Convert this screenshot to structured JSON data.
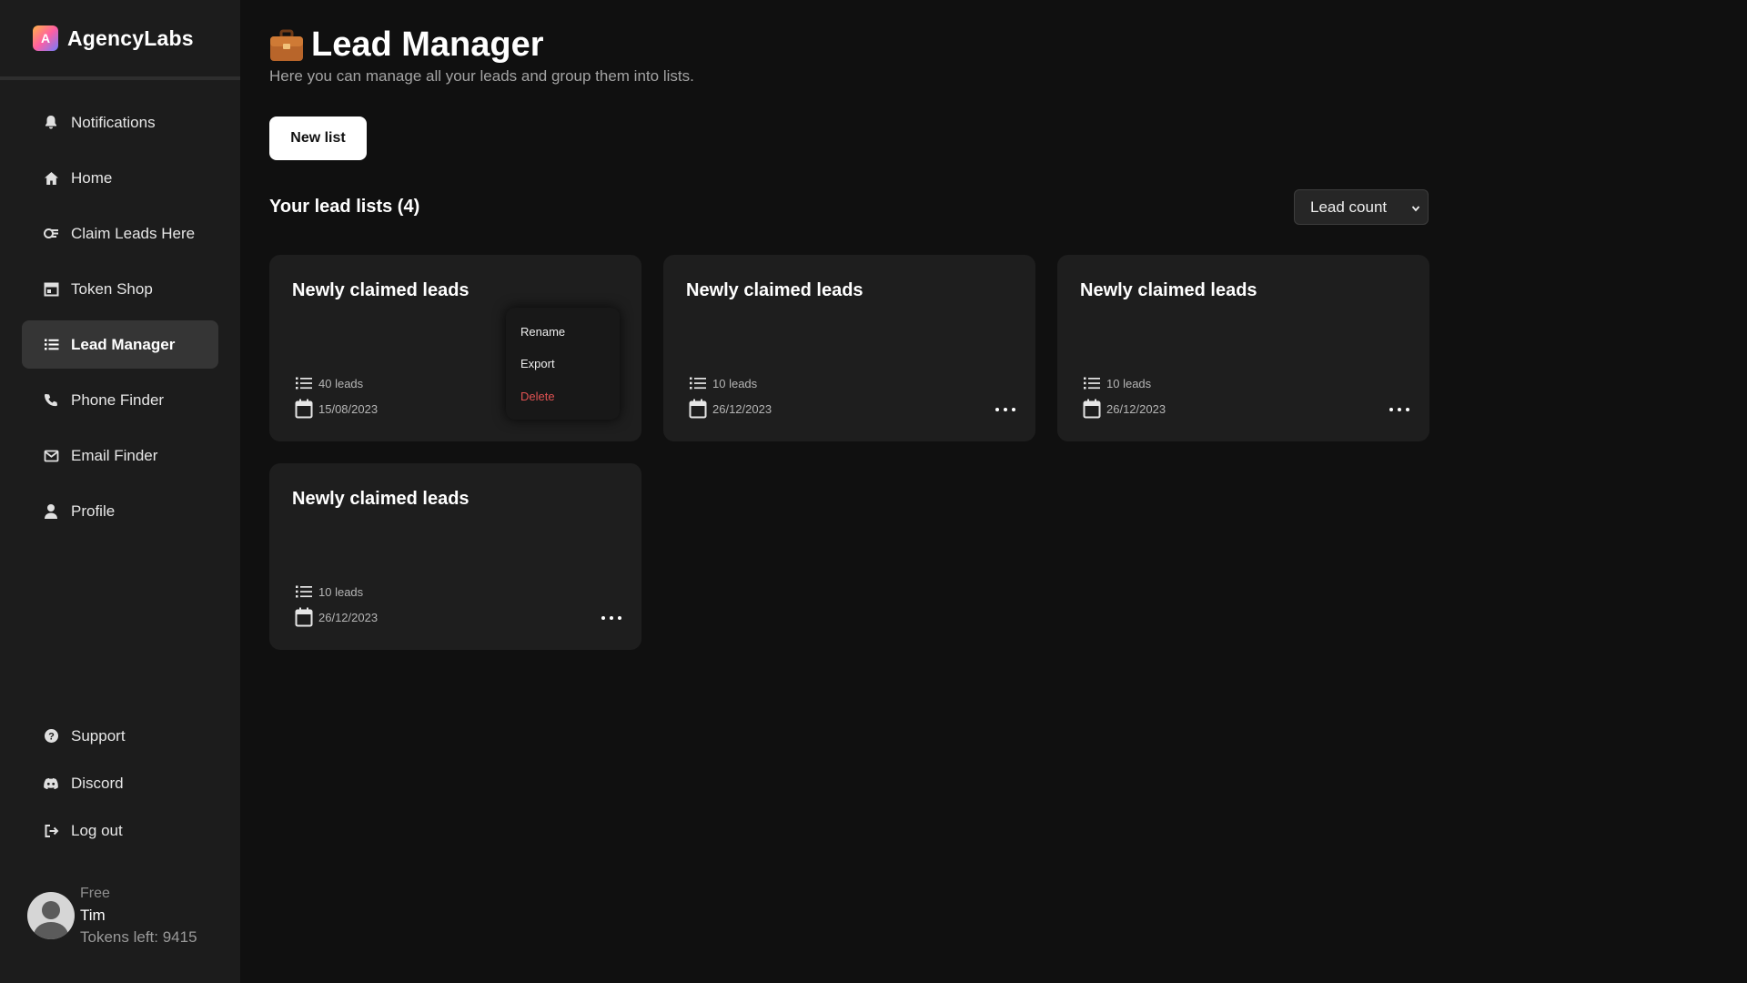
{
  "brand": {
    "name": "AgencyLabs",
    "logo_letter": "A"
  },
  "sidebar": {
    "items": [
      {
        "label": "Notifications",
        "icon": "bell-icon",
        "active": false
      },
      {
        "label": "Home",
        "icon": "home-icon",
        "active": false
      },
      {
        "label": "Claim Leads Here",
        "icon": "claim-icon",
        "active": false
      },
      {
        "label": "Token Shop",
        "icon": "shop-icon",
        "active": false
      },
      {
        "label": "Lead Manager",
        "icon": "list-icon",
        "active": true
      },
      {
        "label": "Phone Finder",
        "icon": "phone-icon",
        "active": false
      },
      {
        "label": "Email Finder",
        "icon": "mail-icon",
        "active": false
      },
      {
        "label": "Profile",
        "icon": "user-icon",
        "active": false
      }
    ],
    "bottom_items": [
      {
        "label": "Support",
        "icon": "help-icon"
      },
      {
        "label": "Discord",
        "icon": "discord-icon"
      },
      {
        "label": "Log out",
        "icon": "logout-icon"
      }
    ],
    "user": {
      "plan": "Free",
      "name": "Tim",
      "tokens": "Tokens left: 9415"
    }
  },
  "main": {
    "title": "Lead Manager",
    "title_icon": "briefcase-icon",
    "subtitle": "Here you can manage all your leads and group them into lists.",
    "new_list_label": "New list",
    "section_title": "Your lead lists (4)",
    "sort": {
      "selected": "Lead count"
    },
    "cards": [
      {
        "title": "Newly claimed leads",
        "count": "40 leads",
        "date": "15/08/2023",
        "menu_open": true
      },
      {
        "title": "Newly claimed leads",
        "count": "10 leads",
        "date": "26/12/2023",
        "menu_open": false
      },
      {
        "title": "Newly claimed leads",
        "count": "10 leads",
        "date": "26/12/2023",
        "menu_open": false
      },
      {
        "title": "Newly claimed leads",
        "count": "10 leads",
        "date": "26/12/2023",
        "menu_open": false
      }
    ],
    "menu": {
      "rename": "Rename",
      "export": "Export",
      "delete": "Delete"
    }
  },
  "colors": {
    "background": "#101010",
    "sidebar": "#1c1c1c",
    "card": "#1e1e1e",
    "active_nav": "#353535",
    "danger": "#e05252"
  }
}
